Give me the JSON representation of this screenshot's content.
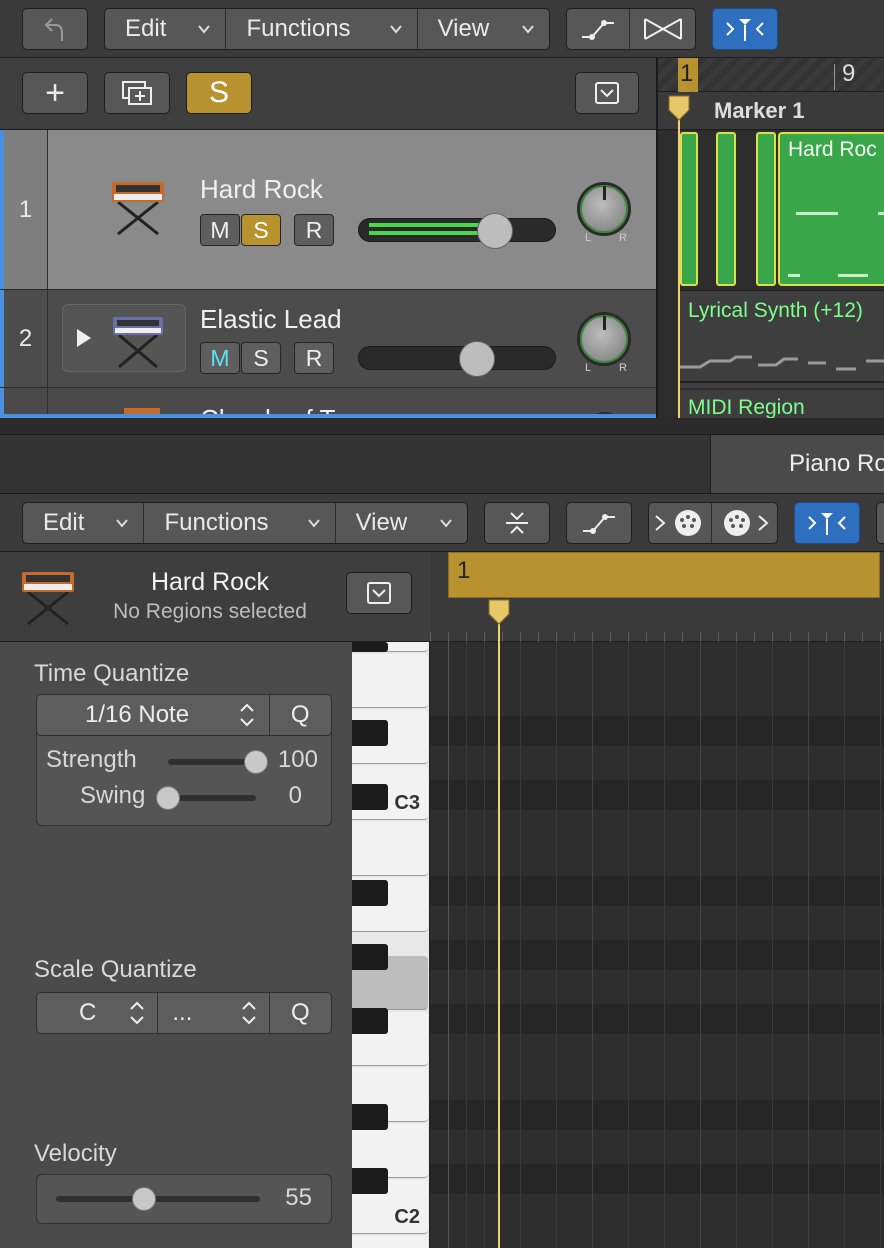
{
  "tracks_toolbar": {
    "menus": [
      {
        "label": "Edit"
      },
      {
        "label": "Functions"
      },
      {
        "label": "View"
      }
    ]
  },
  "tracks_header": {
    "add_label": "+",
    "solo_label": "S"
  },
  "tracks": [
    {
      "number": "1",
      "name": "Hard Rock",
      "m": "M",
      "s": "S",
      "r": "R"
    },
    {
      "number": "2",
      "name": "Elastic Lead",
      "m": "M",
      "s": "S",
      "r": "R"
    },
    {
      "number": "",
      "name": "Chords of Trance"
    }
  ],
  "knob_labels": {
    "l": "L",
    "r": "R"
  },
  "arrange": {
    "ruler_start": "1",
    "ruler_mark": "9",
    "marker": "Marker 1",
    "regions": [
      {
        "label": "Hard Roc"
      },
      {
        "label": "Lyrical Synth (+12)"
      },
      {
        "label": "MIDI Region"
      }
    ]
  },
  "editor": {
    "tab": "Piano Ro",
    "menus": [
      {
        "label": "Edit"
      },
      {
        "label": "Functions"
      },
      {
        "label": "View"
      }
    ],
    "track_name": "Hard Rock",
    "selection_status": "No Regions selected",
    "ruler_bar": "1"
  },
  "time_quantize": {
    "title": "Time Quantize",
    "value": "1/16 Note",
    "q_label": "Q",
    "strength_label": "Strength",
    "strength_value": "100",
    "strength_fraction": 1.0,
    "swing_label": "Swing",
    "swing_value": "0",
    "swing_fraction": 0.0
  },
  "scale_quantize": {
    "title": "Scale Quantize",
    "root": "C",
    "scale": "...",
    "q_label": "Q"
  },
  "velocity": {
    "title": "Velocity",
    "value": "55",
    "fraction": 0.43
  },
  "piano_keys": {
    "c3": "C3",
    "c2": "C2"
  },
  "colors": {
    "accent_blue": "#2f6fbf",
    "solo_gold": "#b8922e",
    "region_green": "#3aa64a",
    "region_text": "#7dff8a",
    "mute_cyan": "#5fe3f0"
  }
}
